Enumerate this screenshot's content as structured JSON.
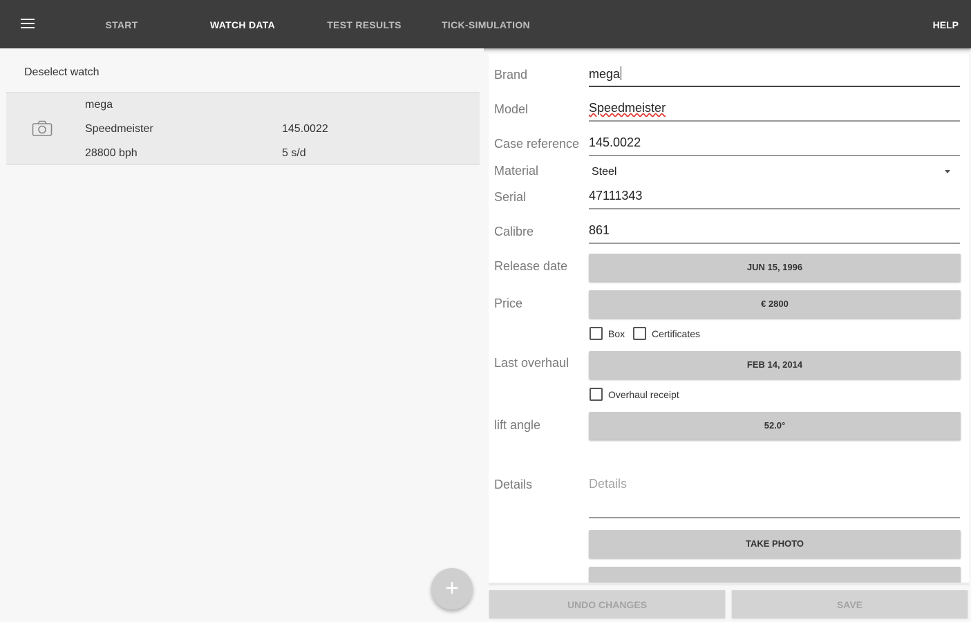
{
  "toolbar": {
    "tabs": [
      "START",
      "WATCH DATA",
      "TEST RESULTS",
      "TICK-SIMULATION"
    ],
    "active_tab": "WATCH DATA",
    "help_label": "HELP"
  },
  "watch_list": {
    "deselect_label": "Deselect watch",
    "items": [
      {
        "brand": "mega",
        "model": "Speedmeister",
        "reference": "145.0022",
        "beat_rate": "28800 bph",
        "rate": "5 s/d"
      }
    ]
  },
  "form": {
    "brand": {
      "label": "Brand",
      "value": "mega"
    },
    "model": {
      "label": "Model",
      "value": "Speedmeister"
    },
    "case_reference": {
      "label": "Case reference",
      "value": "145.0022"
    },
    "material": {
      "label": "Material",
      "value": "Steel"
    },
    "serial": {
      "label": "Serial",
      "value": "47111343"
    },
    "calibre": {
      "label": "Calibre",
      "value": "861"
    },
    "release_date": {
      "label": "Release date",
      "value": "JUN 15, 1996"
    },
    "price": {
      "label": "Price",
      "value": "€ 2800"
    },
    "box": {
      "label": "Box",
      "checked": false
    },
    "certificates": {
      "label": "Certificates",
      "checked": false
    },
    "last_overhaul": {
      "label": "Last overhaul",
      "value": "FEB 14, 2014"
    },
    "overhaul_receipt": {
      "label": "Overhaul receipt",
      "checked": false
    },
    "lift_angle": {
      "label": "lift angle",
      "value": "52.0°"
    },
    "details": {
      "label": "Details",
      "placeholder": "Details"
    },
    "take_photo_label": "TAKE PHOTO"
  },
  "actions": {
    "undo_label": "UNDO CHANGES",
    "save_label": "SAVE"
  }
}
